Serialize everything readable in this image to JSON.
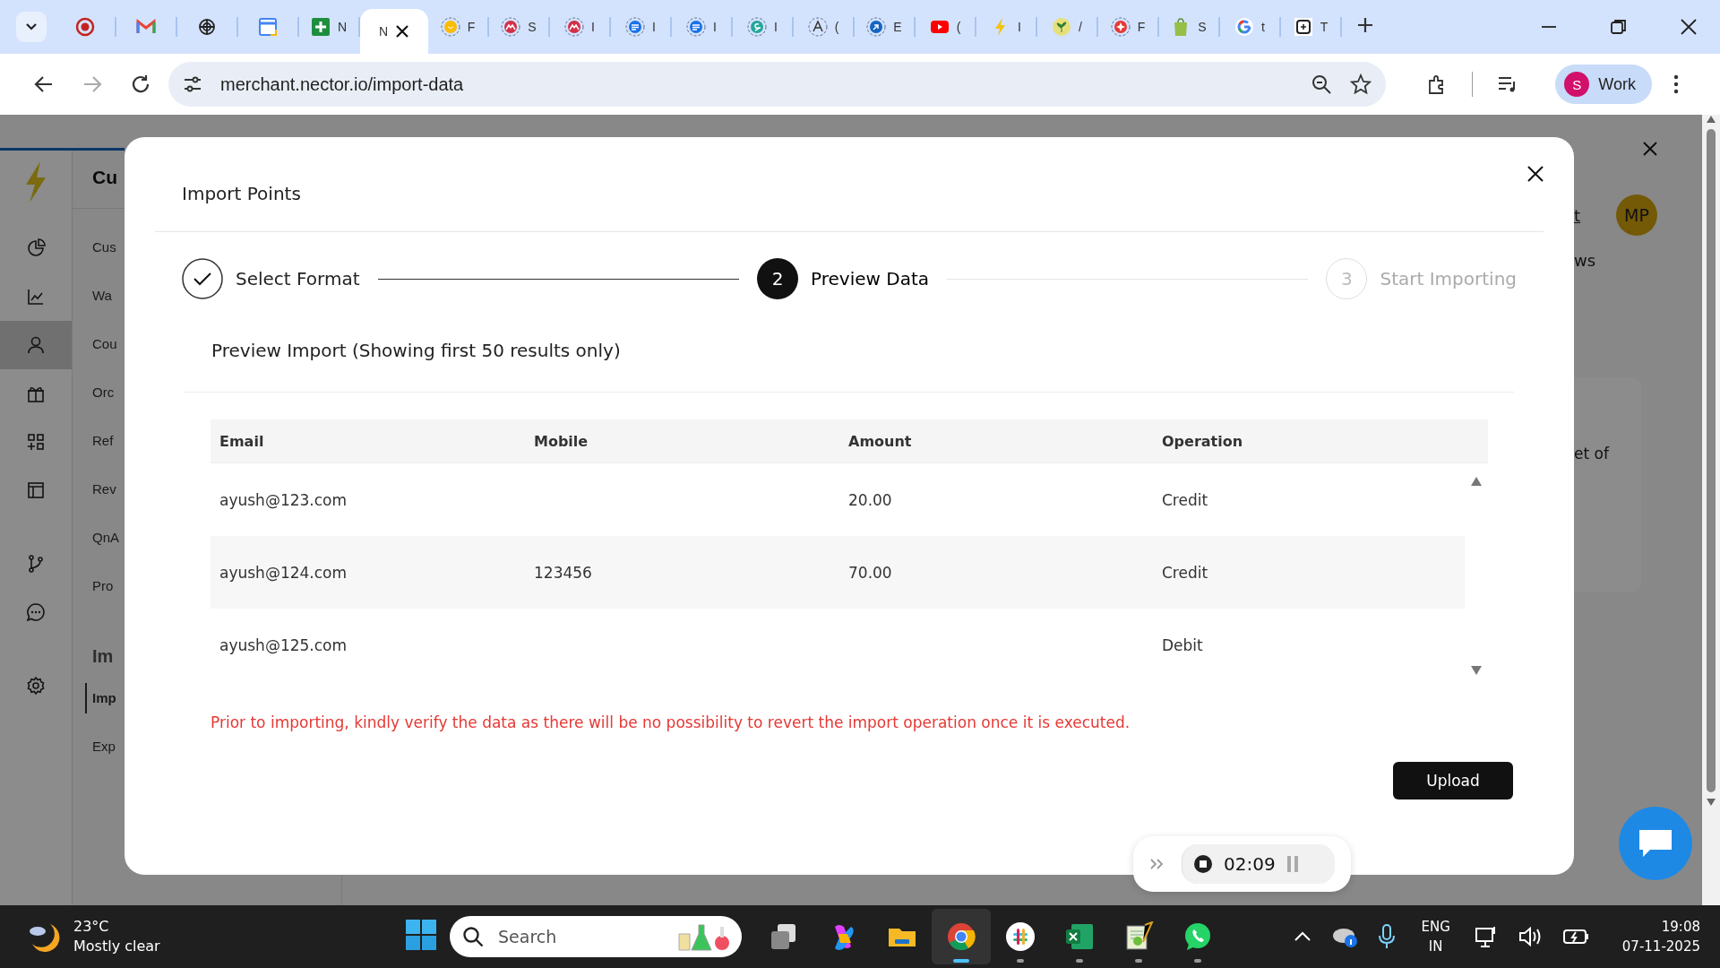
{
  "browser": {
    "tabs": [
      {
        "selected": false
      },
      {
        "selected": false
      },
      {
        "selected": false
      },
      {
        "selected": false
      },
      {
        "title": "N",
        "selected": false
      },
      {
        "title": "N",
        "selected": true
      },
      {
        "title": "F",
        "selected": false
      },
      {
        "title": "S",
        "selected": false
      },
      {
        "title": "I",
        "selected": false
      },
      {
        "title": "I",
        "selected": false
      },
      {
        "title": "I",
        "selected": false
      },
      {
        "title": "I",
        "selected": false
      },
      {
        "title": "(",
        "selected": false
      },
      {
        "title": "E",
        "selected": false
      },
      {
        "title": "(",
        "selected": false
      },
      {
        "title": "I",
        "selected": false
      },
      {
        "title": "/",
        "selected": false
      },
      {
        "title": "F",
        "selected": false
      },
      {
        "title": "S",
        "selected": false
      },
      {
        "title": "t",
        "selected": false
      },
      {
        "title": "T",
        "selected": false
      }
    ],
    "address": "merchant.nector.io/import-data",
    "profile": {
      "initial": "S",
      "label": "Work"
    }
  },
  "background_page": {
    "rail_items": [
      {
        "selected": false
      },
      {
        "selected": false
      },
      {
        "selected": true
      },
      {
        "selected": false
      },
      {
        "selected": false
      },
      {
        "selected": false
      },
      {
        "selected": false
      },
      {
        "selected": false
      },
      {
        "selected": false
      }
    ],
    "heading": "Cu",
    "menu_items": [
      "Cus",
      "Wa",
      "Cou",
      "Orc",
      "Ref",
      "Rev",
      "QnA",
      "Pro"
    ],
    "section_heading": "Im",
    "section_items": [
      {
        "label": "Imp",
        "selected": true
      },
      {
        "label": "Exp",
        "selected": false
      }
    ],
    "link": "t",
    "avatar": "MP",
    "text_1": "ws",
    "text_2": "et of"
  },
  "modal": {
    "title": "Import Points",
    "steps": [
      {
        "label": "Select Format",
        "completed": true,
        "selected": false
      },
      {
        "number": "2",
        "label": "Preview Data",
        "completed": false,
        "selected": true
      },
      {
        "number": "3",
        "label": "Start Importing",
        "completed": false,
        "selected": false
      }
    ],
    "section_title": "Preview Import (Showing first 50 results only)",
    "table": {
      "columns": [
        "Email",
        "Mobile",
        "Amount",
        "Operation"
      ],
      "rows": [
        {
          "email": "ayush@123.com",
          "amount": "20.00",
          "operation": "Credit"
        },
        {
          "email": "ayush@124.com",
          "mobile": "123456",
          "amount": "70.00",
          "operation": "Credit"
        },
        {
          "email": "ayush@125.com",
          "operation": "Debit"
        }
      ]
    },
    "warning": "Prior to importing, kindly verify the data as there will be no possibility to revert the import operation once it is executed.",
    "upload_button": "Upload"
  },
  "recorder": {
    "time": "02:09"
  },
  "taskbar": {
    "weather": {
      "temperature": "23°C",
      "condition": "Mostly clear"
    },
    "search_placeholder": "Search",
    "apps": [
      {
        "running": false,
        "selected": false
      },
      {
        "running": false,
        "selected": false
      },
      {
        "running": false,
        "selected": false
      },
      {
        "running": true,
        "selected": true
      },
      {
        "running": true,
        "selected": false
      },
      {
        "running": true,
        "selected": false
      },
      {
        "running": true,
        "selected": false
      },
      {
        "running": true,
        "selected": false
      }
    ],
    "language": {
      "line_1": "ENG",
      "line_2": "IN"
    },
    "time": "19:08",
    "date": "07-11-2025"
  }
}
